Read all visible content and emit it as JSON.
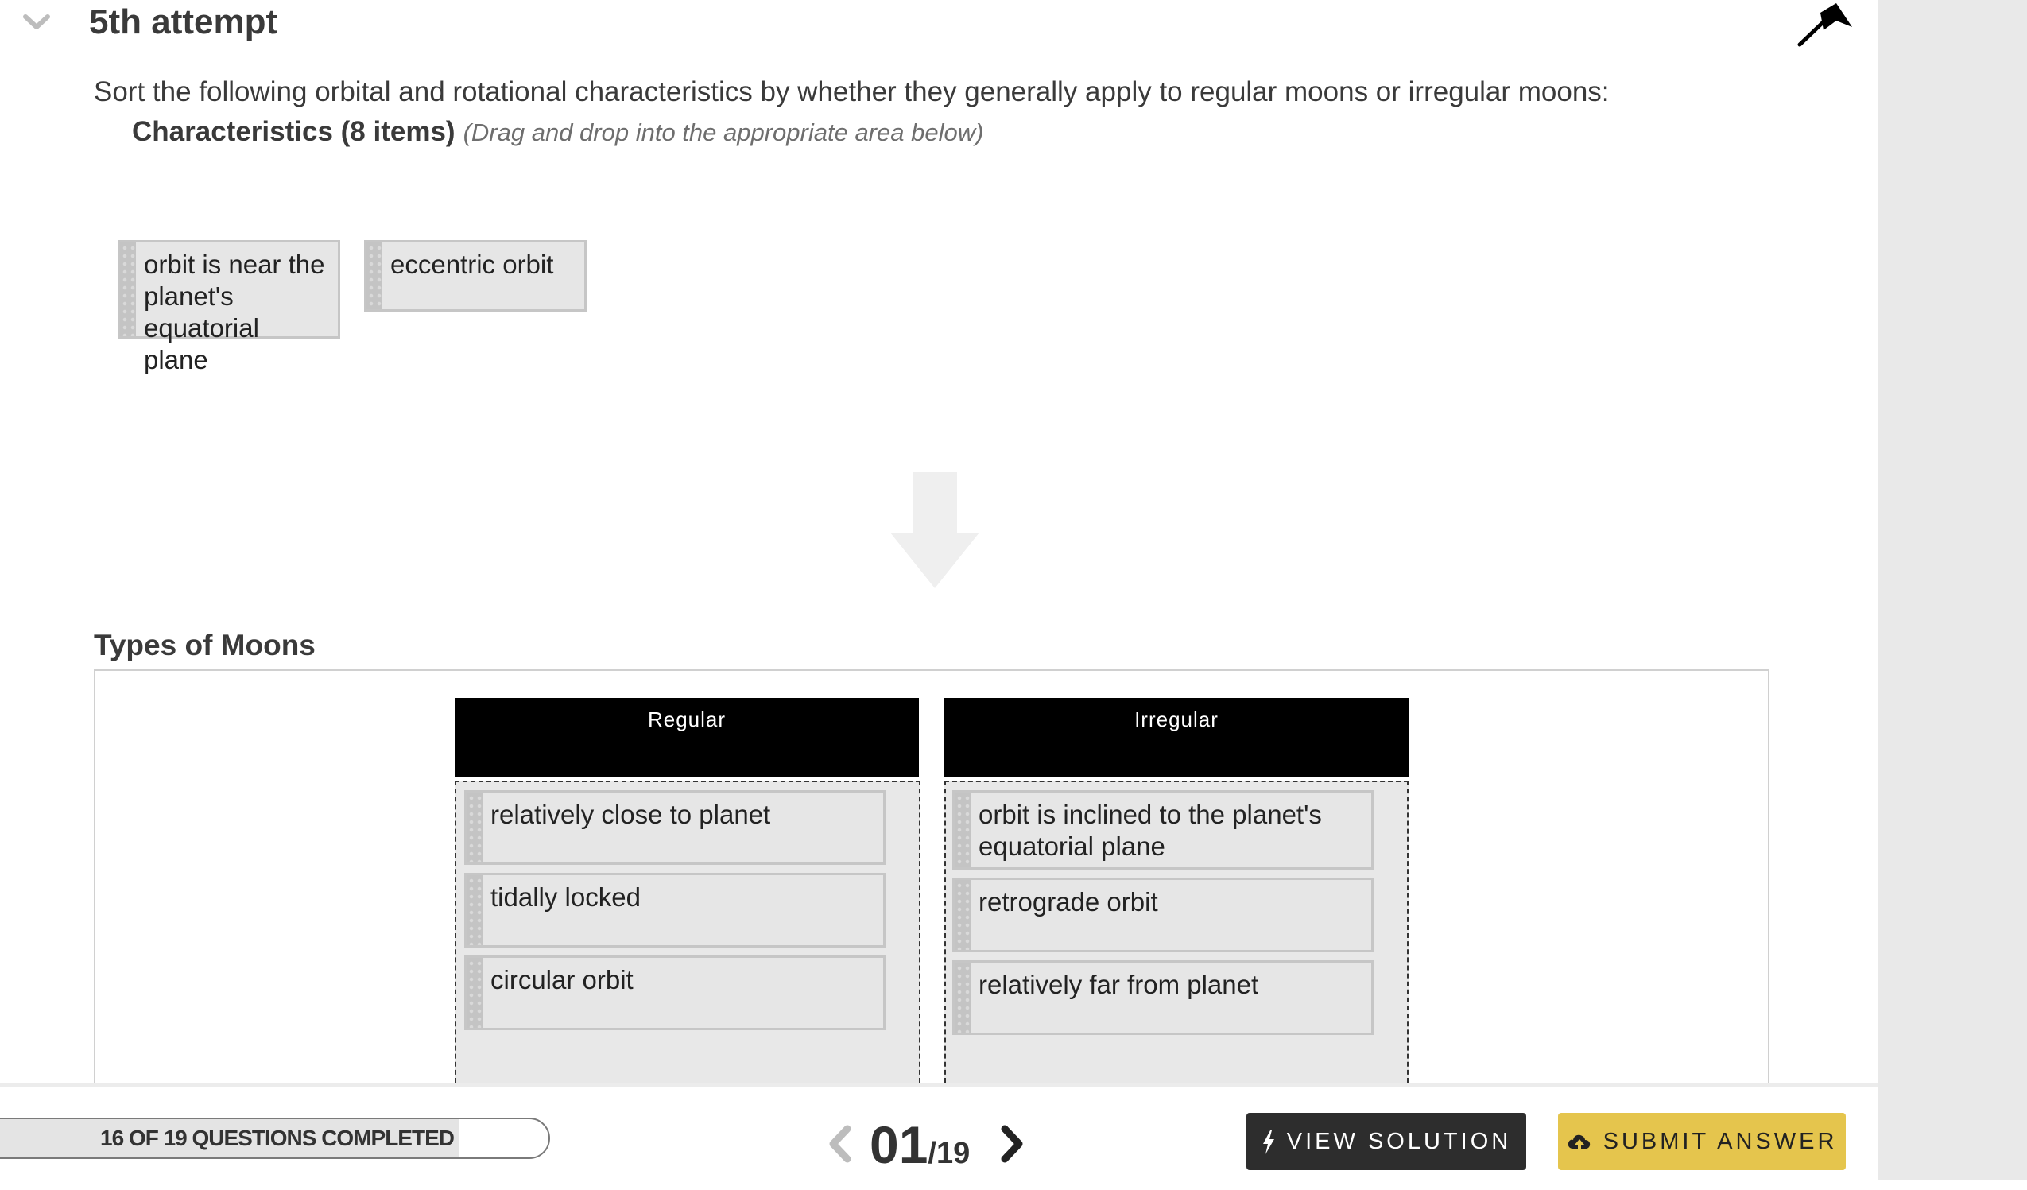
{
  "header": {
    "attempt_title": "5th attempt"
  },
  "question": {
    "prompt": "Sort the following orbital and rotational characteristics by whether they generally apply to regular moons or irregular moons:",
    "characteristics_label": "Characteristics (8 items)",
    "characteristics_hint": "(Drag and drop into the appropriate area below)"
  },
  "source_items": [
    "orbit is near the planet's equatorial plane",
    "eccentric orbit"
  ],
  "target": {
    "heading": "Types of Moons",
    "columns": [
      {
        "title": "Regular",
        "items": [
          "relatively close to planet",
          "tidally locked",
          "circular orbit"
        ]
      },
      {
        "title": "Irregular",
        "items": [
          "orbit is inclined to the planet's equatorial plane",
          "retrograde orbit",
          "relatively far from planet"
        ]
      }
    ]
  },
  "footer": {
    "progress_text": "16 OF 19 QUESTIONS COMPLETED",
    "progress_completed": 16,
    "progress_total": 19,
    "pager_current": "01",
    "pager_total": "/19",
    "view_solution_label": "VIEW SOLUTION",
    "submit_label": "SUBMIT ANSWER"
  },
  "colors": {
    "column_header": "#000000",
    "submit_button": "#e5c54d",
    "view_button": "#2d2d2d"
  },
  "icons": [
    "chevron-down-icon",
    "flag-icon",
    "down-arrow-icon",
    "chevron-left-icon",
    "chevron-right-icon",
    "lightning-icon",
    "cloud-upload-icon"
  ]
}
